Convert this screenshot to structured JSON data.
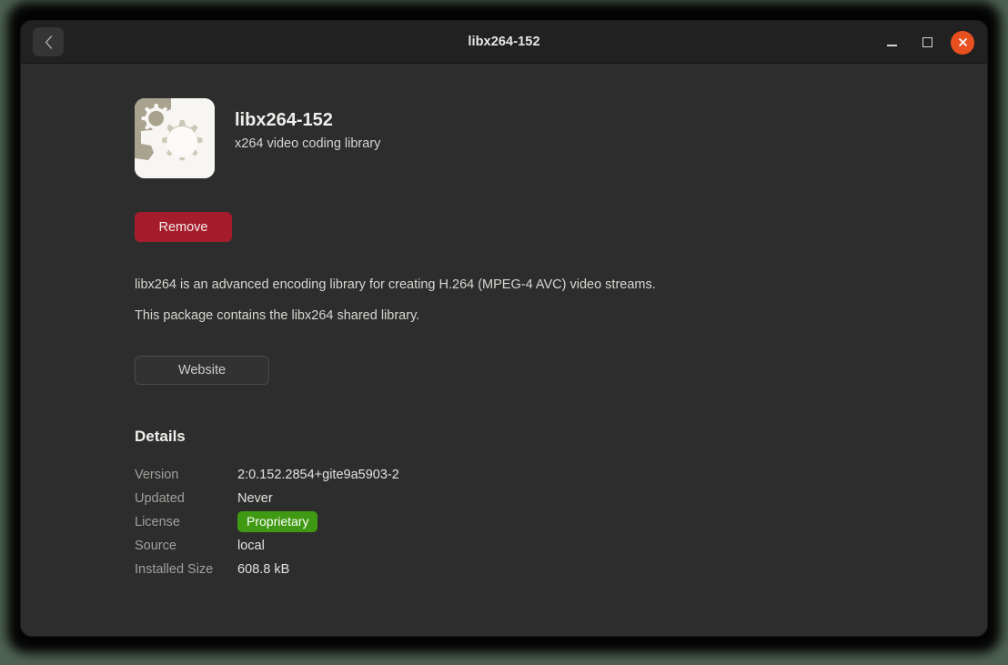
{
  "window": {
    "title": "libx264-152",
    "back_icon": "chevron-left-icon",
    "controls": {
      "minimize_icon": "minimize-icon",
      "maximize_icon": "maximize-icon",
      "close_icon": "close-icon"
    }
  },
  "app": {
    "icon": "package-gears-icon",
    "name": "libx264-152",
    "summary": "x264 video coding library"
  },
  "actions": {
    "remove_label": "Remove",
    "website_label": "Website"
  },
  "description": {
    "paragraphs": [
      "libx264 is an advanced encoding library for creating H.264 (MPEG-4 AVC) video streams.",
      "This package contains the libx264 shared library."
    ]
  },
  "details": {
    "heading": "Details",
    "rows": [
      {
        "label": "Version",
        "value": "2:0.152.2854+gite9a5903-2",
        "type": "text"
      },
      {
        "label": "Updated",
        "value": "Never",
        "type": "text"
      },
      {
        "label": "License",
        "value": "Proprietary",
        "type": "badge"
      },
      {
        "label": "Source",
        "value": "local",
        "type": "text"
      },
      {
        "label": "Installed Size",
        "value": "608.8 kB",
        "type": "text"
      }
    ]
  },
  "colors": {
    "desktop": "#4e6253",
    "titlebar": "#212121",
    "content": "#2d2d2d",
    "remove_button": "#a51d2d",
    "close_button": "#e8501f",
    "license_badge": "#3f9912",
    "icon_light": "#f4f3f0",
    "icon_gear": "#ccc7b5",
    "icon_tan": "#a8a18d"
  }
}
